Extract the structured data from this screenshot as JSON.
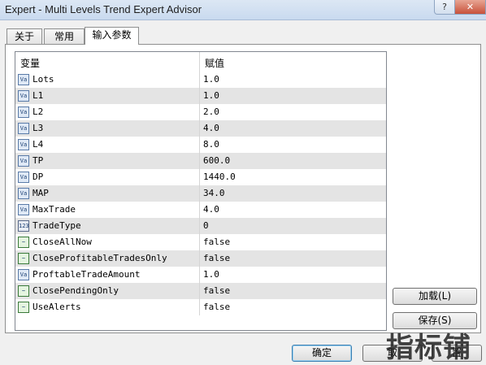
{
  "window": {
    "title": "Expert - Multi Levels Trend Expert Advisor",
    "help_label": "?",
    "close_label": "✕"
  },
  "tabs": [
    {
      "label": "关于"
    },
    {
      "label": "常用"
    },
    {
      "label": "输入参数",
      "active": true
    }
  ],
  "grid": {
    "headers": {
      "variable": "变量",
      "value": "赋值"
    },
    "rows": [
      {
        "icon": "val-icon",
        "icon_text": "Va",
        "name": "Lots",
        "value": "1.0"
      },
      {
        "icon": "val-icon",
        "icon_text": "Va",
        "name": "L1",
        "value": "1.0"
      },
      {
        "icon": "val-icon",
        "icon_text": "Va",
        "name": "L2",
        "value": "2.0"
      },
      {
        "icon": "val-icon",
        "icon_text": "Va",
        "name": "L3",
        "value": "4.0"
      },
      {
        "icon": "val-icon",
        "icon_text": "Va",
        "name": "L4",
        "value": "8.0"
      },
      {
        "icon": "val-icon",
        "icon_text": "Va",
        "name": "TP",
        "value": "600.0"
      },
      {
        "icon": "val-icon",
        "icon_text": "Va",
        "name": "DP",
        "value": "1440.0"
      },
      {
        "icon": "val-icon",
        "icon_text": "Va",
        "name": "MAP",
        "value": "34.0"
      },
      {
        "icon": "val-icon",
        "icon_text": "Va",
        "name": "MaxTrade",
        "value": "4.0"
      },
      {
        "icon": "int-icon",
        "icon_text": "123",
        "name": "TradeType",
        "value": "0"
      },
      {
        "icon": "bool-icon",
        "icon_text": "~",
        "name": "CloseAllNow",
        "value": "false"
      },
      {
        "icon": "bool-icon",
        "icon_text": "~",
        "name": "CloseProfitableTradesOnly",
        "value": "false"
      },
      {
        "icon": "val-icon",
        "icon_text": "Va",
        "name": "ProftableTradeAmount",
        "value": "1.0"
      },
      {
        "icon": "bool-icon",
        "icon_text": "~",
        "name": "ClosePendingOnly",
        "value": "false"
      },
      {
        "icon": "bool-icon",
        "icon_text": "~",
        "name": "UseAlerts",
        "value": "false"
      }
    ]
  },
  "buttons": {
    "load": "加载(L)",
    "save": "保存(S)",
    "ok": "确定",
    "cancel": "取",
    "reset": "置"
  },
  "watermark": "指标铺"
}
